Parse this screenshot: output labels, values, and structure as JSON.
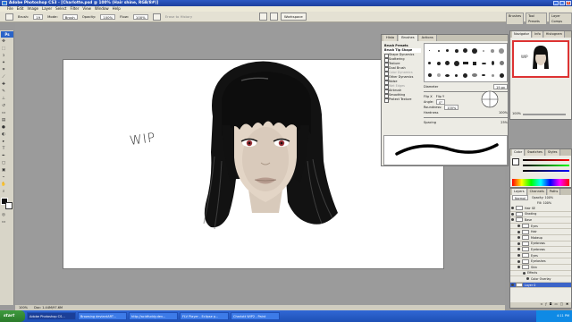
{
  "window": {
    "title": "Adobe Photoshop CS3 - [Charlotte.psd @ 100% (Hair shine, RGB/8#)]"
  },
  "menu": [
    "File",
    "Edit",
    "Image",
    "Layer",
    "Select",
    "Filter",
    "View",
    "Window",
    "Help"
  ],
  "options": {
    "brush_label": "Brush:",
    "brush_size": "19",
    "mode_label": "Mode:",
    "mode_value": "Brush",
    "opacity_label": "Opacity:",
    "opacity_value": "100%",
    "flow_label": "Flow:",
    "flow_value": "100%",
    "erase_label": "Erase to History",
    "workspace": "Workspace"
  },
  "right_tabs": [
    "Brushes",
    "Tool Presets",
    "Layer Comps"
  ],
  "canvas": {
    "annotation": "WIP"
  },
  "status": {
    "zoom": "100%",
    "doc": "Doc: 1.44M/97.6M"
  },
  "brushes_panel": {
    "tabs": [
      "Histo",
      "Brushes",
      "Actions"
    ],
    "list": [
      "Brush Presets",
      "Brush Tip Shape",
      "Shape Dynamics",
      "Scattering",
      "Texture",
      "Dual Brush",
      "Color Dynamics",
      "Other Dynamics",
      "Noise",
      "Wet Edges",
      "Airbrush",
      "Smoothing",
      "Protect Texture"
    ],
    "diameter_label": "Diameter",
    "diameter_value": "19 px",
    "flipx": "Flip X",
    "flipy": "Flip Y",
    "angle_label": "Angle:",
    "angle_value": "0°",
    "roundness_label": "Roundness:",
    "roundness_value": "100%",
    "hardness_label": "Hardness",
    "hardness_value": "100%",
    "spacing_label": "Spacing",
    "spacing_value": "25%"
  },
  "navigator": {
    "tabs": [
      "Navigator",
      "Info",
      "Histogram"
    ],
    "zoom": "100%"
  },
  "color": {
    "tabs": [
      "Color",
      "Swatches",
      "Styles"
    ]
  },
  "layers": {
    "tabs": [
      "Layers",
      "Channels",
      "Paths"
    ],
    "blend": "Normal",
    "opacity": "Opacity: 100%",
    "fill": "Fill: 100%",
    "rows": [
      "Hair SE",
      "Shading",
      "Base",
      "Eyes",
      "Hair",
      "Makeup",
      "Eyebrows",
      "Eyebrows",
      "Eyes",
      "Eyelashes",
      "Skin",
      "Effects",
      "Color Overlay",
      "Layer 0"
    ]
  },
  "taskbar": {
    "start": "start",
    "items": [
      "Adobe Photoshop CS...",
      "Browsing deviantART...",
      "http://acidfuddy.dev...",
      "FLV Player - Eclipse p...",
      "Charlott WIP2 - Paint"
    ],
    "clock": "4:11 PM"
  },
  "colors": {
    "title_bar": "#2c59c4",
    "canvas": "#ffffff",
    "workspace": "#9b9b9b",
    "hair": "#0e0e0e",
    "skin": "#e2d3c4"
  }
}
